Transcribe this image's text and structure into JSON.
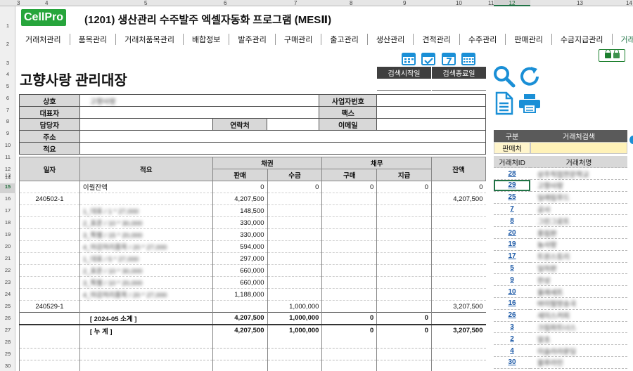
{
  "columns": [
    "3",
    "4",
    "5",
    "6",
    "7",
    "8",
    "9",
    "10",
    "11",
    "12",
    "13",
    "14"
  ],
  "selected_column": "12",
  "rows": [
    "1",
    "2",
    "3",
    "4",
    "5",
    "6",
    "7",
    "8",
    "9",
    "10",
    "11",
    "12",
    "13",
    "14",
    "15",
    "16",
    "17",
    "18",
    "19",
    "20",
    "21",
    "22",
    "23",
    "24",
    "25",
    "26",
    "27",
    "28",
    "29",
    "30"
  ],
  "selected_row": "15",
  "app": {
    "logo": "CellPro",
    "title": "(1201) 생산관리 수주발주 엑셀자동화 프로그램 (MESⅡ)"
  },
  "menu": [
    "거래처관리",
    "품목관리",
    "거래처품목관리",
    "배합정보",
    "발주관리",
    "구매관리",
    "출고관리",
    "생산관리",
    "견적관리",
    "수주관리",
    "판매관리",
    "수금지급관리",
    "거래처"
  ],
  "page_title": "고향사랑 관리대장",
  "search": {
    "start_label": "검색시작일",
    "end_label": "검색종료일"
  },
  "info": {
    "company_label": "상호",
    "company_value": "고향사랑",
    "bizno_label": "사업자번호",
    "ceo_label": "대표자",
    "fax_label": "팩스",
    "manager_label": "담당자",
    "contact_label": "연락처",
    "email_label": "이메일",
    "address_label": "주소",
    "memo_label": "적요"
  },
  "ledger": {
    "headers": {
      "date": "일자",
      "memo": "적요",
      "receivable": "채권",
      "payable": "채무",
      "balance": "잔액",
      "sales": "판매",
      "collect": "수금",
      "purchase": "구매",
      "payment": "지급"
    },
    "rows": [
      {
        "date": "",
        "memo": "이월잔액",
        "sales": "0",
        "collect": "0",
        "purchase": "0",
        "payment": "0",
        "balance": "0",
        "type": "line"
      },
      {
        "date": "240502-1",
        "memo": "",
        "sales": "4,207,500",
        "collect": "",
        "purchase": "",
        "payment": "",
        "balance": "4,207,500",
        "type": "line"
      },
      {
        "date": "",
        "memo": "1_대표 / 1 * 27,000",
        "sales": "148,500",
        "collect": "",
        "purchase": "",
        "payment": "",
        "balance": "",
        "type": "item"
      },
      {
        "date": "",
        "memo": "2_표준 / 10 * 30,000",
        "sales": "330,000",
        "collect": "",
        "purchase": "",
        "payment": "",
        "balance": "",
        "type": "item"
      },
      {
        "date": "",
        "memo": "3_특별 / 15 * 20,000",
        "sales": "330,000",
        "collect": "",
        "purchase": "",
        "payment": "",
        "balance": "",
        "type": "item"
      },
      {
        "date": "",
        "memo": "4_마감처리품목 / 20 * 27,000",
        "sales": "594,000",
        "collect": "",
        "purchase": "",
        "payment": "",
        "balance": "",
        "type": "item"
      },
      {
        "date": "",
        "memo": "1_대표 / 5 * 27,000",
        "sales": "297,000",
        "collect": "",
        "purchase": "",
        "payment": "",
        "balance": "",
        "type": "item"
      },
      {
        "date": "",
        "memo": "2_표준 / 10 * 30,000",
        "sales": "660,000",
        "collect": "",
        "purchase": "",
        "payment": "",
        "balance": "",
        "type": "item"
      },
      {
        "date": "",
        "memo": "3_특별 / 10 * 20,000",
        "sales": "660,000",
        "collect": "",
        "purchase": "",
        "payment": "",
        "balance": "",
        "type": "item"
      },
      {
        "date": "",
        "memo": "4_마감처리품목 / 20 * 27,000",
        "sales": "1,188,000",
        "collect": "",
        "purchase": "",
        "payment": "",
        "balance": "",
        "type": "item"
      },
      {
        "date": "240529-1",
        "memo": "",
        "sales": "",
        "collect": "1,000,000",
        "purchase": "",
        "payment": "",
        "balance": "3,207,500",
        "type": "line"
      },
      {
        "date": "",
        "memo": "[ 2024-05 소계 ]",
        "sales": "4,207,500",
        "collect": "1,000,000",
        "purchase": "0",
        "payment": "0",
        "balance": "",
        "type": "sub"
      },
      {
        "date": "",
        "memo": "[ 누    계 ]",
        "sales": "4,207,500",
        "collect": "1,000,000",
        "purchase": "0",
        "payment": "0",
        "balance": "3,207,500",
        "type": "tot"
      }
    ]
  },
  "panel": {
    "col_kind": "구분",
    "col_search": "거래처검색",
    "customer_label": "판매처",
    "list_id_header": "거래처ID",
    "list_name_header": "거래처명",
    "customers": [
      {
        "id": "28",
        "name": "상주직업전문학교"
      },
      {
        "id": "29",
        "name": "고향사랑"
      },
      {
        "id": "25",
        "name": "일래림푸드"
      },
      {
        "id": "7",
        "name": "공사"
      },
      {
        "id": "8",
        "name": "그린그로트"
      },
      {
        "id": "20",
        "name": "풍림판"
      },
      {
        "id": "19",
        "name": "농사랑"
      },
      {
        "id": "17",
        "name": "트윈스토리"
      },
      {
        "id": "5",
        "name": "일하판"
      },
      {
        "id": "9",
        "name": "한성"
      },
      {
        "id": "10",
        "name": "울래세트"
      },
      {
        "id": "16",
        "name": "바이럴방송국"
      },
      {
        "id": "26",
        "name": "세이스커피"
      },
      {
        "id": "3",
        "name": "크림파트너스"
      },
      {
        "id": "2",
        "name": "알초"
      },
      {
        "id": "4",
        "name": "이슬라라운딩"
      },
      {
        "id": "30",
        "name": "블루라인"
      }
    ]
  },
  "colors": {
    "logo_green": "#27a53c",
    "header_gray": "#3f3f3f",
    "link_blue": "#1d5aa7",
    "icon_blue": "#1a8fd6"
  }
}
